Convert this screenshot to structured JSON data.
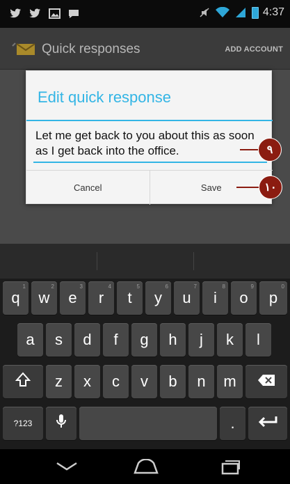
{
  "status_bar": {
    "left_icons": [
      "twitter-icon",
      "twitter-icon",
      "image-icon",
      "chat-icon"
    ],
    "time": "4:37"
  },
  "action_bar": {
    "title": "Quick responses",
    "add_account": "ADD ACCOUNT"
  },
  "dialog": {
    "title": "Edit quick response",
    "response_text": "Let me get back to you about this as soon as I get back into the office.",
    "cancel_label": "Cancel",
    "save_label": "Save"
  },
  "callouts": [
    {
      "label": "٩",
      "target": "response-input"
    },
    {
      "label": "١٠",
      "target": "save-button"
    }
  ],
  "keyboard": {
    "row1": [
      {
        "label": "q",
        "hint": "1"
      },
      {
        "label": "w",
        "hint": "2"
      },
      {
        "label": "e",
        "hint": "3"
      },
      {
        "label": "r",
        "hint": "4"
      },
      {
        "label": "t",
        "hint": "5"
      },
      {
        "label": "y",
        "hint": "6"
      },
      {
        "label": "u",
        "hint": "7"
      },
      {
        "label": "i",
        "hint": "8"
      },
      {
        "label": "o",
        "hint": "9"
      },
      {
        "label": "p",
        "hint": "0"
      }
    ],
    "row2": [
      "a",
      "s",
      "d",
      "f",
      "g",
      "h",
      "j",
      "k",
      "l"
    ],
    "row3": [
      "z",
      "x",
      "c",
      "v",
      "b",
      "n",
      "m"
    ],
    "symbols_label": "?123",
    "period_label": ".",
    "shift_icon": "shift-icon",
    "backspace_icon": "backspace-icon",
    "mic_icon": "microphone-icon",
    "enter_icon": "enter-icon"
  },
  "nav_bar": {
    "icons": [
      "back-icon",
      "home-icon",
      "recent-apps-icon"
    ]
  }
}
